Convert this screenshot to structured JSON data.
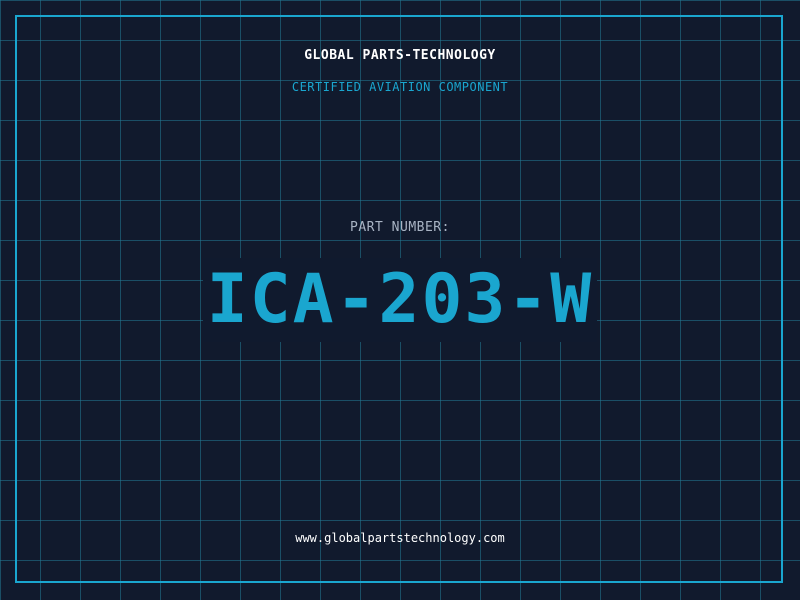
{
  "header": {
    "company": "GLOBAL PARTS-TECHNOLOGY",
    "tagline": "CERTIFIED AVIATION COMPONENT"
  },
  "part": {
    "label": "PART NUMBER:",
    "number": "ICA-203-W"
  },
  "footer": {
    "website": "www.globalpartstechnology.com"
  },
  "colors": {
    "background": "#111a2d",
    "grid": "#227a96",
    "accent": "#1aa6cf",
    "text_primary": "#ffffff",
    "text_muted": "#a9b4c4"
  }
}
